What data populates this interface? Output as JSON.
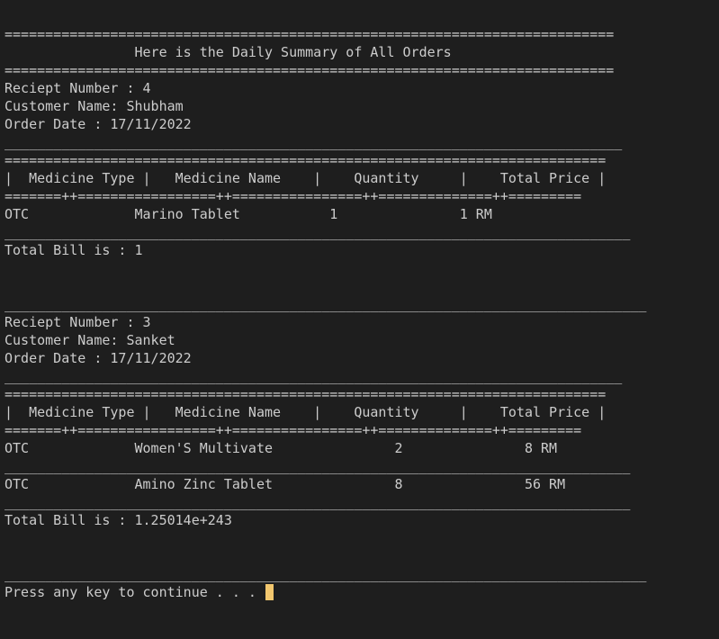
{
  "console": {
    "lines": [
      "===========================================================================",
      "                Here is the Daily Summary of All Orders",
      "===========================================================================",
      "Reciept Number : 4",
      "Customer Name: Shubham",
      "Order Date : 17/11/2022",
      "____________________________________________________________________________",
      "==========================================================================",
      "|  Medicine Type |   Medicine Name    |    Quantity     |    Total Price |",
      "=======++=================++================++==============++=========",
      "OTC             Marino Tablet           1               1 RM",
      "_____________________________________________________________________________",
      "Total Bill is : 1",
      "",
      "",
      "_______________________________________________________________________________",
      "Reciept Number : 3",
      "Customer Name: Sanket",
      "Order Date : 17/11/2022",
      "____________________________________________________________________________",
      "==========================================================================",
      "|  Medicine Type |   Medicine Name    |    Quantity     |    Total Price |",
      "=======++=================++================++==============++=========",
      "OTC             Women'S Multivate               2               8 RM",
      "_____________________________________________________________________________",
      "OTC             Amino Zinc Tablet               8               56 RM",
      "_____________________________________________________________________________",
      "Total Bill is : 1.25014e+243",
      "",
      "",
      "_______________________________________________________________________________"
    ],
    "prompt": "Press any key to continue . . . "
  }
}
